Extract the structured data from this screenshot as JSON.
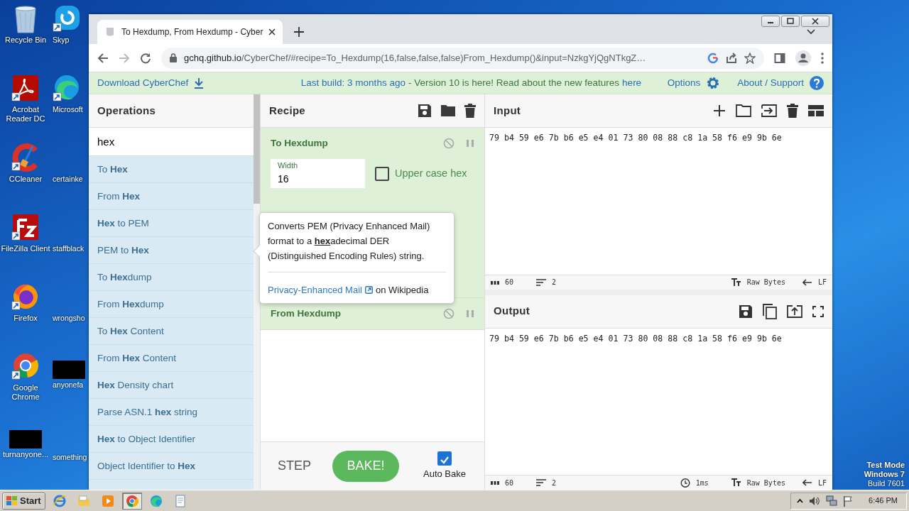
{
  "desktop": {
    "icons": [
      {
        "label": "Recycle Bin",
        "kind": "bin"
      },
      {
        "label": "Skyp",
        "kind": "chat"
      },
      {
        "label": "Acrobat Reader DC",
        "kind": "pdf"
      },
      {
        "label": "Microsoft",
        "kind": "edge"
      },
      {
        "label": "CCleaner",
        "kind": "cleaner"
      },
      {
        "label": "certainke",
        "kind": "blank"
      },
      {
        "label": "FileZilla Client",
        "kind": "ftp"
      },
      {
        "label": "staffblack",
        "kind": "blank"
      },
      {
        "label": "Firefox",
        "kind": "fox"
      },
      {
        "label": "wrongsho",
        "kind": "blank"
      },
      {
        "label": "Google Chrome",
        "kind": "chrome"
      },
      {
        "label": "anyonefa",
        "kind": "dark"
      },
      {
        "label": "turnanyone...",
        "kind": "dark"
      },
      {
        "label": "something",
        "kind": "blank"
      }
    ],
    "notice": [
      "Test Mode",
      "Windows 7",
      "Build 7601"
    ]
  },
  "browser": {
    "tab": {
      "title": "To Hexdump, From Hexdump - Cyber"
    },
    "url": {
      "domain": "gchq.github.io",
      "path": "/CyberChef/#recipe=To_Hexdump(16,false,false,false)From_Hexdump()&input=NzkgYjQgNTkgZ…"
    }
  },
  "banner": {
    "download": "Download CyberChef",
    "build_link": "Last build: 3 months ago",
    "notice": "- Version 10 is here! Read about the new features",
    "notice_link": "here",
    "options": "Options",
    "about": "About / Support"
  },
  "operations": {
    "title": "Operations",
    "search": {
      "value": "hex"
    },
    "items": [
      {
        "label": "To **Hex**"
      },
      {
        "label": "From **Hex**"
      },
      {
        "label": "**Hex** to PEM"
      },
      {
        "label": "PEM to **Hex**"
      },
      {
        "label": "To **Hex**dump"
      },
      {
        "label": "From **Hex**dump"
      },
      {
        "label": "To **Hex** Content"
      },
      {
        "label": "From **Hex** Content"
      },
      {
        "label": "**Hex** Density chart"
      },
      {
        "label": "Parse ASN.1 **hex** string"
      },
      {
        "label": "**Hex** to Object Identifier"
      },
      {
        "label": "Object Identifier to **Hex**"
      }
    ]
  },
  "recipe": {
    "title": "Recipe",
    "steps": [
      {
        "name": "To Hexdump",
        "args": [
          {
            "kind": "number",
            "label": "Width",
            "value": "16"
          },
          {
            "kind": "checkbox",
            "label": "Upper case hex",
            "checked": false
          }
        ]
      },
      {
        "name": "From Hexdump"
      }
    ],
    "step_button": "STEP",
    "bake_button": "BAKE!",
    "auto_bake": {
      "label": "Auto Bake",
      "checked": true
    }
  },
  "tooltip": {
    "text": "Converts PEM (Privacy Enhanced Mail) format to a **hex**adecimal DER (Distinguished Encoding Rules) string.",
    "link": "Privacy-Enhanced Mail",
    "link_suffix": "on Wikipedia"
  },
  "input": {
    "title": "Input",
    "text": "79 b4 59 e6 7b b6 e5 e4 01 73 80 08 88 c8 1a 58 f6 e9 9b 6e",
    "status": {
      "length": "60",
      "lines": "2",
      "encoding": "Raw Bytes",
      "eol": "LF"
    }
  },
  "output": {
    "title": "Output",
    "text": "79 b4 59 e6 7b b6 e5 e4 01 73 80 08 88 c8 1a 58 f6 e9 9b 6e",
    "status": {
      "length": "60",
      "lines": "2",
      "time": "1ms",
      "encoding": "Raw Bytes",
      "eol": "LF"
    }
  },
  "taskbar": {
    "start": "Start",
    "apps": [
      {
        "kind": "ie",
        "selected": false
      },
      {
        "kind": "folder",
        "selected": false
      },
      {
        "kind": "media",
        "selected": false
      },
      {
        "kind": "chrome",
        "selected": true
      },
      {
        "kind": "edge",
        "selected": false
      },
      {
        "kind": "notepad",
        "selected": false
      }
    ],
    "clock": "6:46 PM"
  }
}
